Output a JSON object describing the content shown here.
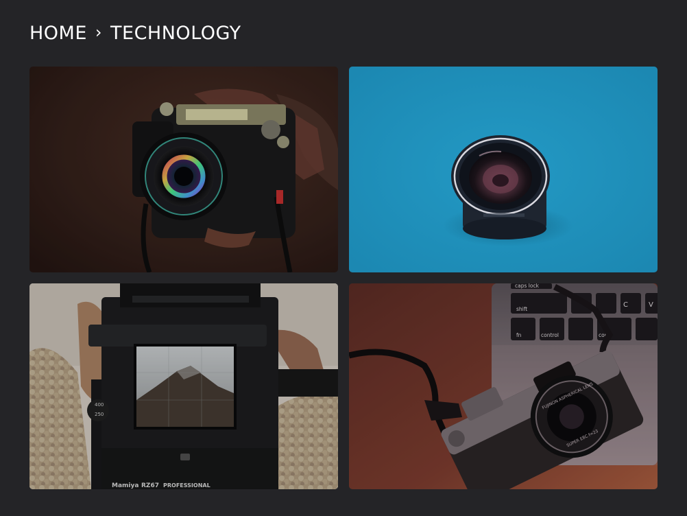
{
  "breadcrumb": {
    "home_label": "HOME",
    "separator": "›",
    "current_label": "TECHNOLOGY"
  },
  "gallery": {
    "tiles": [
      {
        "name": "fujifilm-camera-in-hand",
        "keys": []
      },
      {
        "name": "camera-lens-on-blue",
        "keys": []
      },
      {
        "name": "mamiya-rz67-viewfinder",
        "brand": "Mamiya",
        "model": "RZ67",
        "label": "PROFESSIONAL",
        "dial_values": [
          "400",
          "250"
        ]
      },
      {
        "name": "fujifilm-x100-on-laptop",
        "keys": [
          "caps lock",
          "shift",
          "fn",
          "control",
          "con",
          "C",
          "V"
        ],
        "lens_text": "FUJINON ASPHERICAL LENS",
        "lens_spec": "SUPER EBC f=23"
      }
    ]
  },
  "colors": {
    "background": "#242427",
    "text": "#ffffff",
    "tile2_blue": "#1f93bb"
  }
}
